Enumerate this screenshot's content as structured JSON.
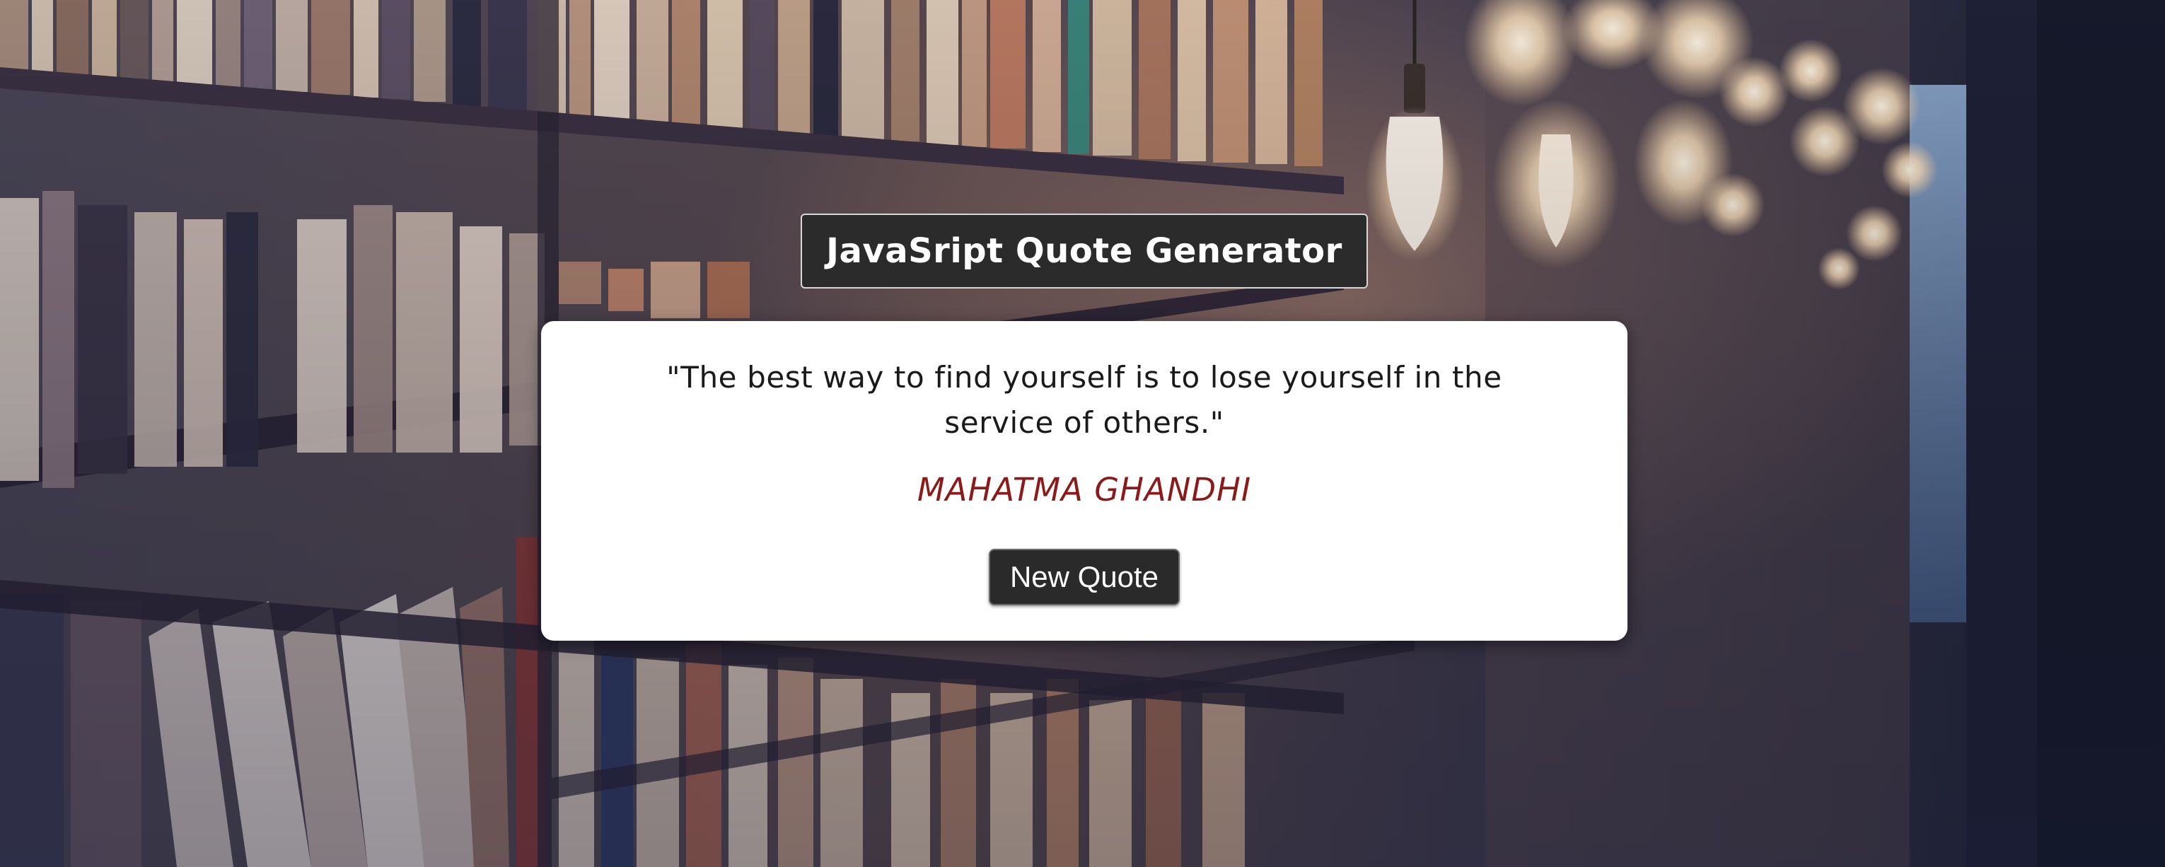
{
  "header": {
    "title": "JavaSript Quote Generator"
  },
  "quote": {
    "text": "\"The best way to find yourself is to lose yourself in the service of others.\"",
    "author": "MAHATMA GHANDHI"
  },
  "actions": {
    "new_quote_label": "New Quote"
  },
  "colors": {
    "title_bg": "#2b2b2b",
    "card_bg": "#ffffff",
    "author_color": "#8b1a1a",
    "button_bg": "#2a2a2a"
  }
}
